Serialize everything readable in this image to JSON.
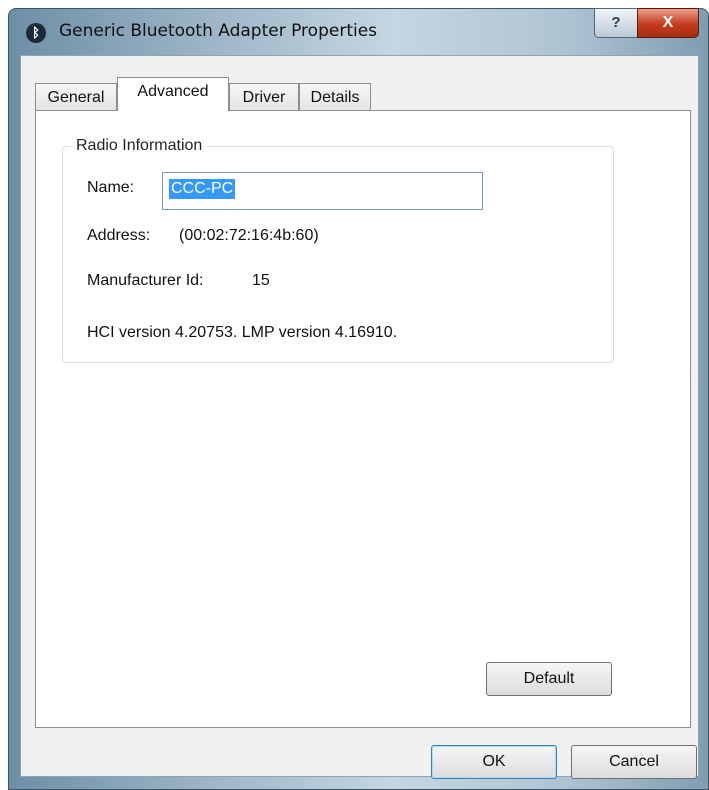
{
  "window": {
    "title": "Generic Bluetooth Adapter Properties",
    "title_icon": "bluetooth-icon",
    "help_label": "?",
    "close_label": "X"
  },
  "tabs": [
    {
      "label": "General",
      "active": false
    },
    {
      "label": "Advanced",
      "active": true
    },
    {
      "label": "Driver",
      "active": false
    },
    {
      "label": "Details",
      "active": false
    }
  ],
  "radio_info": {
    "legend": "Radio Information",
    "name_label": "Name:",
    "name_value": "CCC-PC",
    "address_label": "Address:",
    "address_value": "(00:02:72:16:4b:60)",
    "manufacturer_label": "Manufacturer Id:",
    "manufacturer_value": "15",
    "versions": "HCI version 4.20753.  LMP version 4.16910."
  },
  "buttons": {
    "default": "Default",
    "ok": "OK",
    "cancel": "Cancel"
  },
  "colors": {
    "selection": "#3399ff",
    "close_button": "#c43a1c"
  }
}
